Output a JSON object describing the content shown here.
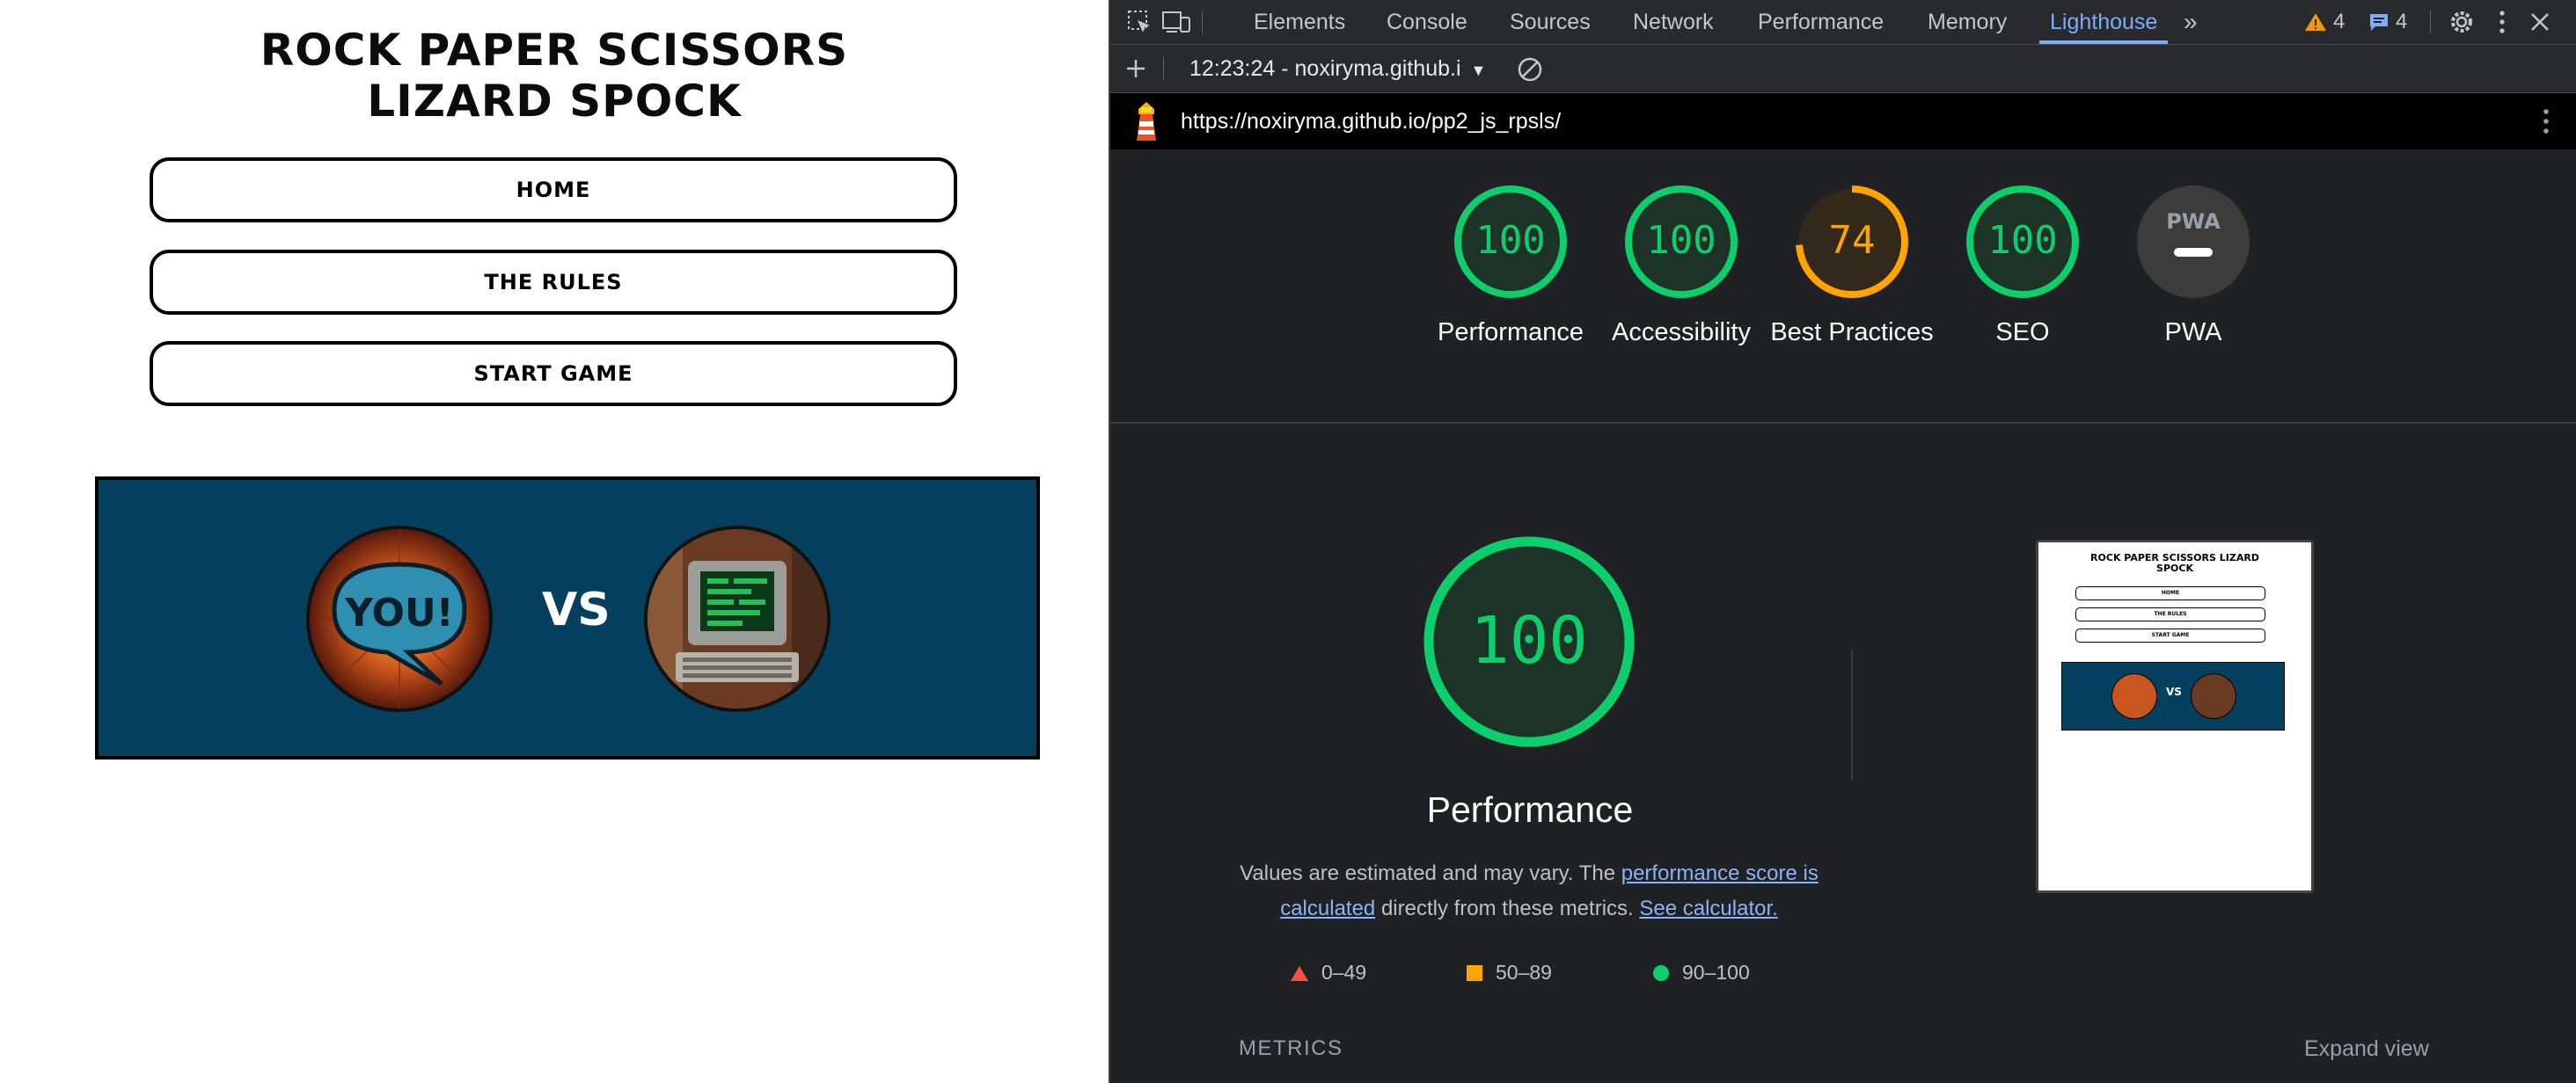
{
  "site": {
    "title": "ROCK PAPER SCISSORS LIZARD SPOCK",
    "nav": [
      "HOME",
      "THE RULES",
      "START GAME"
    ],
    "vs": "VS",
    "avatar_you_text": "YOU!"
  },
  "devtools": {
    "tabs": [
      "Elements",
      "Console",
      "Sources",
      "Network",
      "Performance",
      "Memory",
      "Lighthouse"
    ],
    "active_tab": "Lighthouse",
    "warnings_count": "4",
    "messages_count": "4",
    "report_selector": "12:23:24 - noxiryma.github.i",
    "url": "https://noxiryma.github.io/pp2_js_rpsls/",
    "scores": [
      {
        "label": "Performance",
        "score": "100",
        "value": 100,
        "color": "#0cce6b"
      },
      {
        "label": "Accessibility",
        "score": "100",
        "value": 100,
        "color": "#0cce6b"
      },
      {
        "label": "Best Practices",
        "score": "74",
        "value": 74,
        "color": "#ffa400"
      },
      {
        "label": "SEO",
        "score": "100",
        "value": 100,
        "color": "#0cce6b"
      },
      {
        "label": "PWA",
        "score": "",
        "value": null,
        "color": "#9aa0a6"
      }
    ],
    "pwa_badge": "PWA",
    "main_score": "100",
    "main_label": "Performance",
    "desc_prefix": "Values are estimated and may vary. The",
    "desc_link1": "performance score is calculated",
    "desc_middle": "directly from these metrics.",
    "desc_link2": "See calculator.",
    "legend": [
      {
        "range": "0–49",
        "color": "#ff4e42",
        "shape": "triangle"
      },
      {
        "range": "50–89",
        "color": "#ffa400",
        "shape": "square"
      },
      {
        "range": "90–100",
        "color": "#0cce6b",
        "shape": "circle"
      }
    ],
    "metrics_heading": "METRICS",
    "expand_view": "Expand view"
  },
  "thumbnail": {
    "title": "ROCK PAPER SCISSORS LIZARD SPOCK",
    "nav": [
      "HOME",
      "THE RULES",
      "START GAME"
    ],
    "vs": "VS"
  }
}
